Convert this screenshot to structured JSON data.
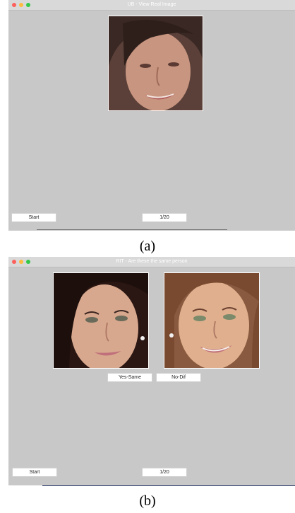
{
  "window_a": {
    "title": "UB - View Real Image",
    "start_label": "Start",
    "counter": "1/20"
  },
  "caption_a": "(a)",
  "window_b": {
    "title": "RIT - Are these the same person",
    "start_label": "Start",
    "counter": "1/20",
    "yes_label": "Yes-Same",
    "no_label": "No-Dif"
  },
  "caption_b": "(b)"
}
